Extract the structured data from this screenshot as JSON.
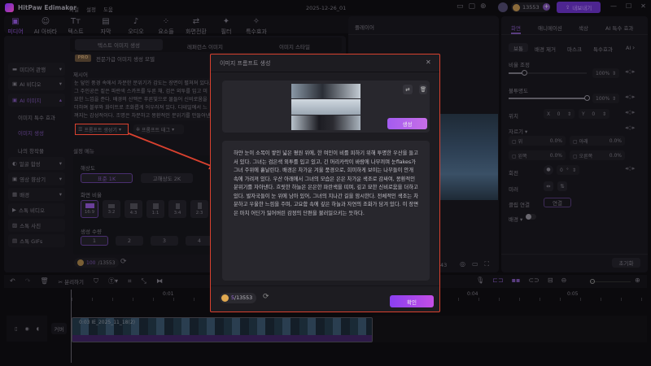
{
  "titlebar": {
    "app_name": "HitPaw Edimakor",
    "menus": [
      "파일",
      "설정",
      "도움"
    ],
    "project": "2025-12-26_01",
    "coins": "13553",
    "export_label": "내보내기"
  },
  "toolbar": [
    {
      "label": "미디어",
      "icon": "media-icon"
    },
    {
      "label": "AI 아바타",
      "icon": "avatar-icon"
    },
    {
      "label": "텍스트",
      "icon": "text-icon"
    },
    {
      "label": "자막",
      "icon": "subtitle-icon"
    },
    {
      "label": "오디오",
      "icon": "audio-icon"
    },
    {
      "label": "요소들",
      "icon": "elements-icon"
    },
    {
      "label": "화면전환",
      "icon": "transition-icon"
    },
    {
      "label": "필터",
      "icon": "filter-icon"
    },
    {
      "label": "특수효과",
      "icon": "effects-icon"
    }
  ],
  "sidebar": {
    "items": [
      "미디어 관행",
      "AI 비디오",
      "AI 이미지",
      "이미지 특수 효과",
      "이미지 생성",
      "나의 창작물",
      "얼굴 합성",
      "영상 향상기",
      "배경",
      "스톡 비디오",
      "스톡 사진",
      "스톡 GIFs"
    ]
  },
  "generator": {
    "tabs": [
      "텍스트 이미지 생성",
      "레퍼런스 이미지",
      "이미지 스타일"
    ],
    "pro_badge": "PRO",
    "pro_text": "전문가급 이미지 생성 모델",
    "prompt_label": "제시어",
    "prompt_text": "눈 덮인 풍경 속에서 차분한 분위기가 감도는 장면이 펼쳐져 있다. 그 주인공은 짙은 파란색 스카프를 두른 채, 검은 외투를 입고 미묘한 느낌을 준다. 배경의 산맥은 푸른빛으로 물들어 신비로움을 더하며 블루와 화이트로 조화롭게 어우러져 있다. 디테일에서 느껴지는 감성적이다. 조명은 차분하고 몽환적인 분위기를 만들어낸다.",
    "prompt_gen_btn": "프롬프트 생성기",
    "prompt_tag_btn": "프롬프트 태그",
    "settings_label": "설정 메뉴",
    "resolution_label": "해상도",
    "resolutions": [
      "표준 1K",
      "고해상도 2K"
    ],
    "ratio_label": "화면 비율",
    "ratios": [
      "16:9",
      "3:2",
      "4:3",
      "1:1",
      "3:4",
      "2:3"
    ],
    "count_label": "생성 수량",
    "counts": [
      "1",
      "2",
      "3",
      "4"
    ],
    "credits_used": "100",
    "credits_total": "/13553"
  },
  "player": {
    "label": "플레이어",
    "time_partial": "43"
  },
  "modal": {
    "title": "이미지 프롬프트 생성",
    "generate_btn": "생성",
    "text": "하얀 눈이 소복이 쌓인 넓은 평원 위에, 한 여인이 비를 피하기 위해 투명한 우산을 들고 서 있다. 그녀는 검은색 외투를 입고 있고, 긴 머리카락이 바람에 나부끼며 눈flakes가 그녀 주위에 흩날린다. 배경은 차가운 겨울 풍경으로, 희미하게 보이는 나무들이 안개 속에 가려져 있다. 우산 아래에서 그녀의 모습은 은은 차가운 색조로 감싸여, 몽환적인 분위기를 자아낸다. 흐릿한 하늘은 은은한 파란색을 띠며, 깊고 묘한 신비로움을 더하고 있다. 발자국들이 눈 위에 남아 있어, 그녀의 지나간 길을 암시한다. 전체적인 색조는 차분하고 우울한 느낌을 주며, 고요함 속에 깊은 하늘과 자연의 조화가 담겨 있다. 이 장면은 마치 어딘가 잃어버린 감정의 단편을 불러일으키는 듯하다.",
    "credits_used": "5",
    "credits_total": "/13553",
    "confirm_btn": "확인"
  },
  "right": {
    "tabs": [
      "화면",
      "애니메이션",
      "색상",
      "AI 특수 효과"
    ],
    "subtabs": [
      "보통",
      "배경 제거",
      "마스크",
      "특수효과",
      "AI"
    ],
    "scale_label": "비율 조정",
    "scale_value": "100%",
    "scale_fraction": 0.2,
    "opacity_label": "불투명도",
    "opacity_value": "100%",
    "opacity_fraction": 1.0,
    "position_label": "위치",
    "x_label": "X",
    "x_value": "0",
    "y_label": "Y",
    "y_value": "0",
    "crop_label": "자르기",
    "crop": [
      {
        "label": "위",
        "value": "0.0%"
      },
      {
        "label": "아래",
        "value": "0.0%"
      },
      {
        "label": "왼쪽",
        "value": "0.0%"
      },
      {
        "label": "오른쪽",
        "value": "0.0%"
      }
    ],
    "rotate_label": "회전",
    "rotate_value": "0",
    "rotate_unit": "°",
    "mirror_label": "미러",
    "clip_link_label": "클립 연결",
    "clip_link_btn": "연결",
    "bg_label": "배경",
    "reset_btn": "초기화"
  },
  "timeline": {
    "split_label": "분리하기",
    "ticks": [
      "0:01",
      "0:04",
      "0:05"
    ],
    "track_label": "커버",
    "clip_label": "0:03 IE_2025_11_18(2)"
  },
  "colors": {
    "accent": "#9b4ef0",
    "highlight": "#e0453a"
  }
}
